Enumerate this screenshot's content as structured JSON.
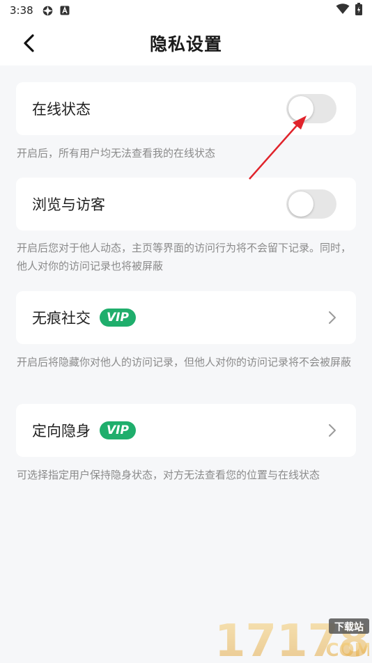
{
  "status_bar": {
    "time": "3:38",
    "icons": [
      "settings-icon",
      "notification-a-icon",
      "wifi-icon",
      "battery-icon"
    ]
  },
  "header": {
    "title": "隐私设置",
    "back_icon": "chevron-left-icon"
  },
  "settings": {
    "online_status": {
      "label": "在线状态",
      "enabled": false,
      "description": "开启后，所有用户均无法查看我的在线状态"
    },
    "browse_visitors": {
      "label": "浏览与访客",
      "enabled": false,
      "description": "开启后您对于他人动态，主页等界面的访问行为将不会留下记录。同时， 他人对你的访问记录也将被屏蔽"
    },
    "traceless_social": {
      "label": "无痕社交",
      "badge": "VIP",
      "description": "开启后将隐藏你对他人的访问记录，但他人对你的访问记录将不会被屏蔽"
    },
    "targeted_invisible": {
      "label": "定向隐身",
      "badge": "VIP",
      "description": "可选择指定用户保持隐身状态，对方无法查看您的位置与在线状态"
    }
  },
  "watermark": {
    "text": "17178",
    "sub_top": "下载站",
    "sub_bottom": "COM"
  },
  "colors": {
    "vip_badge": "#1fae6c",
    "annotation_arrow": "#e0232b",
    "background": "#f6f7f9"
  }
}
